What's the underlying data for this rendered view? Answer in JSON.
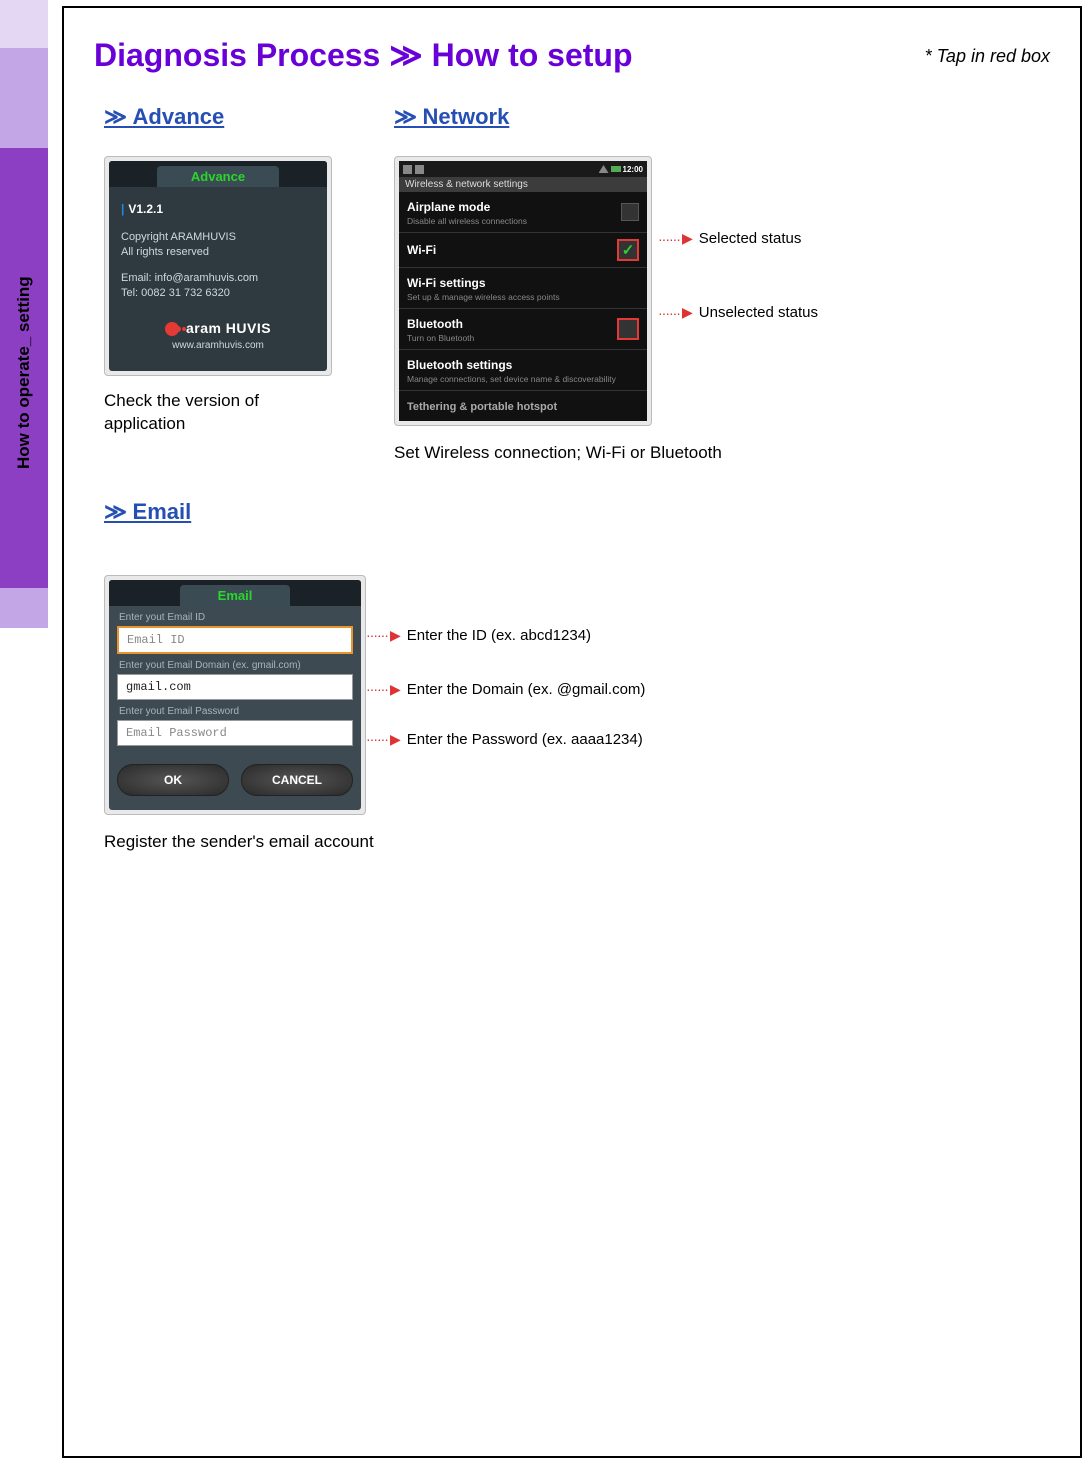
{
  "sidebar": {
    "label": "How to operate_ setting"
  },
  "header": {
    "title_a": "Diagnosis Process ",
    "title_chev": "≫",
    "title_b": " How to setup",
    "hint": "* Tap in red box"
  },
  "advance": {
    "heading_chev": "≫ ",
    "heading": "Advance",
    "tab": "Advance",
    "version": "V1.2.1",
    "copyright": "Copyright ARAMHUVIS\nAll rights reserved",
    "email_line": "Email: info@aramhuvis.com",
    "tel_line": "Tel: 0082 31 732 6320",
    "logo_text": "aram HUVIS",
    "url": "www.aramhuvis.com",
    "caption": "Check the version of application"
  },
  "network": {
    "heading_chev": "≫ ",
    "heading": "Network",
    "status_time": "12:00",
    "hdr": "Wireless & network settings",
    "rows": {
      "airplane": {
        "t": "Airplane mode",
        "s": "Disable all wireless connections"
      },
      "wifi": {
        "t": "Wi-Fi"
      },
      "wifiset": {
        "t": "Wi-Fi settings",
        "s": "Set up & manage wireless access points"
      },
      "bt": {
        "t": "Bluetooth",
        "s": "Turn on Bluetooth"
      },
      "btset": {
        "t": "Bluetooth settings",
        "s": "Manage connections, set device name & discoverability"
      },
      "teth": {
        "t": "Tethering & portable hotspot"
      }
    },
    "co_selected": "Selected status",
    "co_unselected": "Unselected status",
    "caption": "Set Wireless connection; Wi-Fi or Bluetooth"
  },
  "email": {
    "heading_chev": "≫ ",
    "heading": "Email",
    "tab": "Email",
    "lbl_id": "Enter yout Email ID",
    "ph_id": "Email ID",
    "lbl_dom": "Enter yout Email Domain (ex. gmail.com)",
    "val_dom": "gmail.com",
    "lbl_pw": "Enter yout Email Password",
    "ph_pw": "Email Password",
    "btn_ok": "OK",
    "btn_cancel": "CANCEL",
    "co_id": "Enter the ID (ex. abcd1234)",
    "co_dom": "Enter the Domain (ex. @gmail.com)",
    "co_pw": "Enter the Password (ex. aaaa1234)",
    "caption": "Register the sender's email account"
  }
}
